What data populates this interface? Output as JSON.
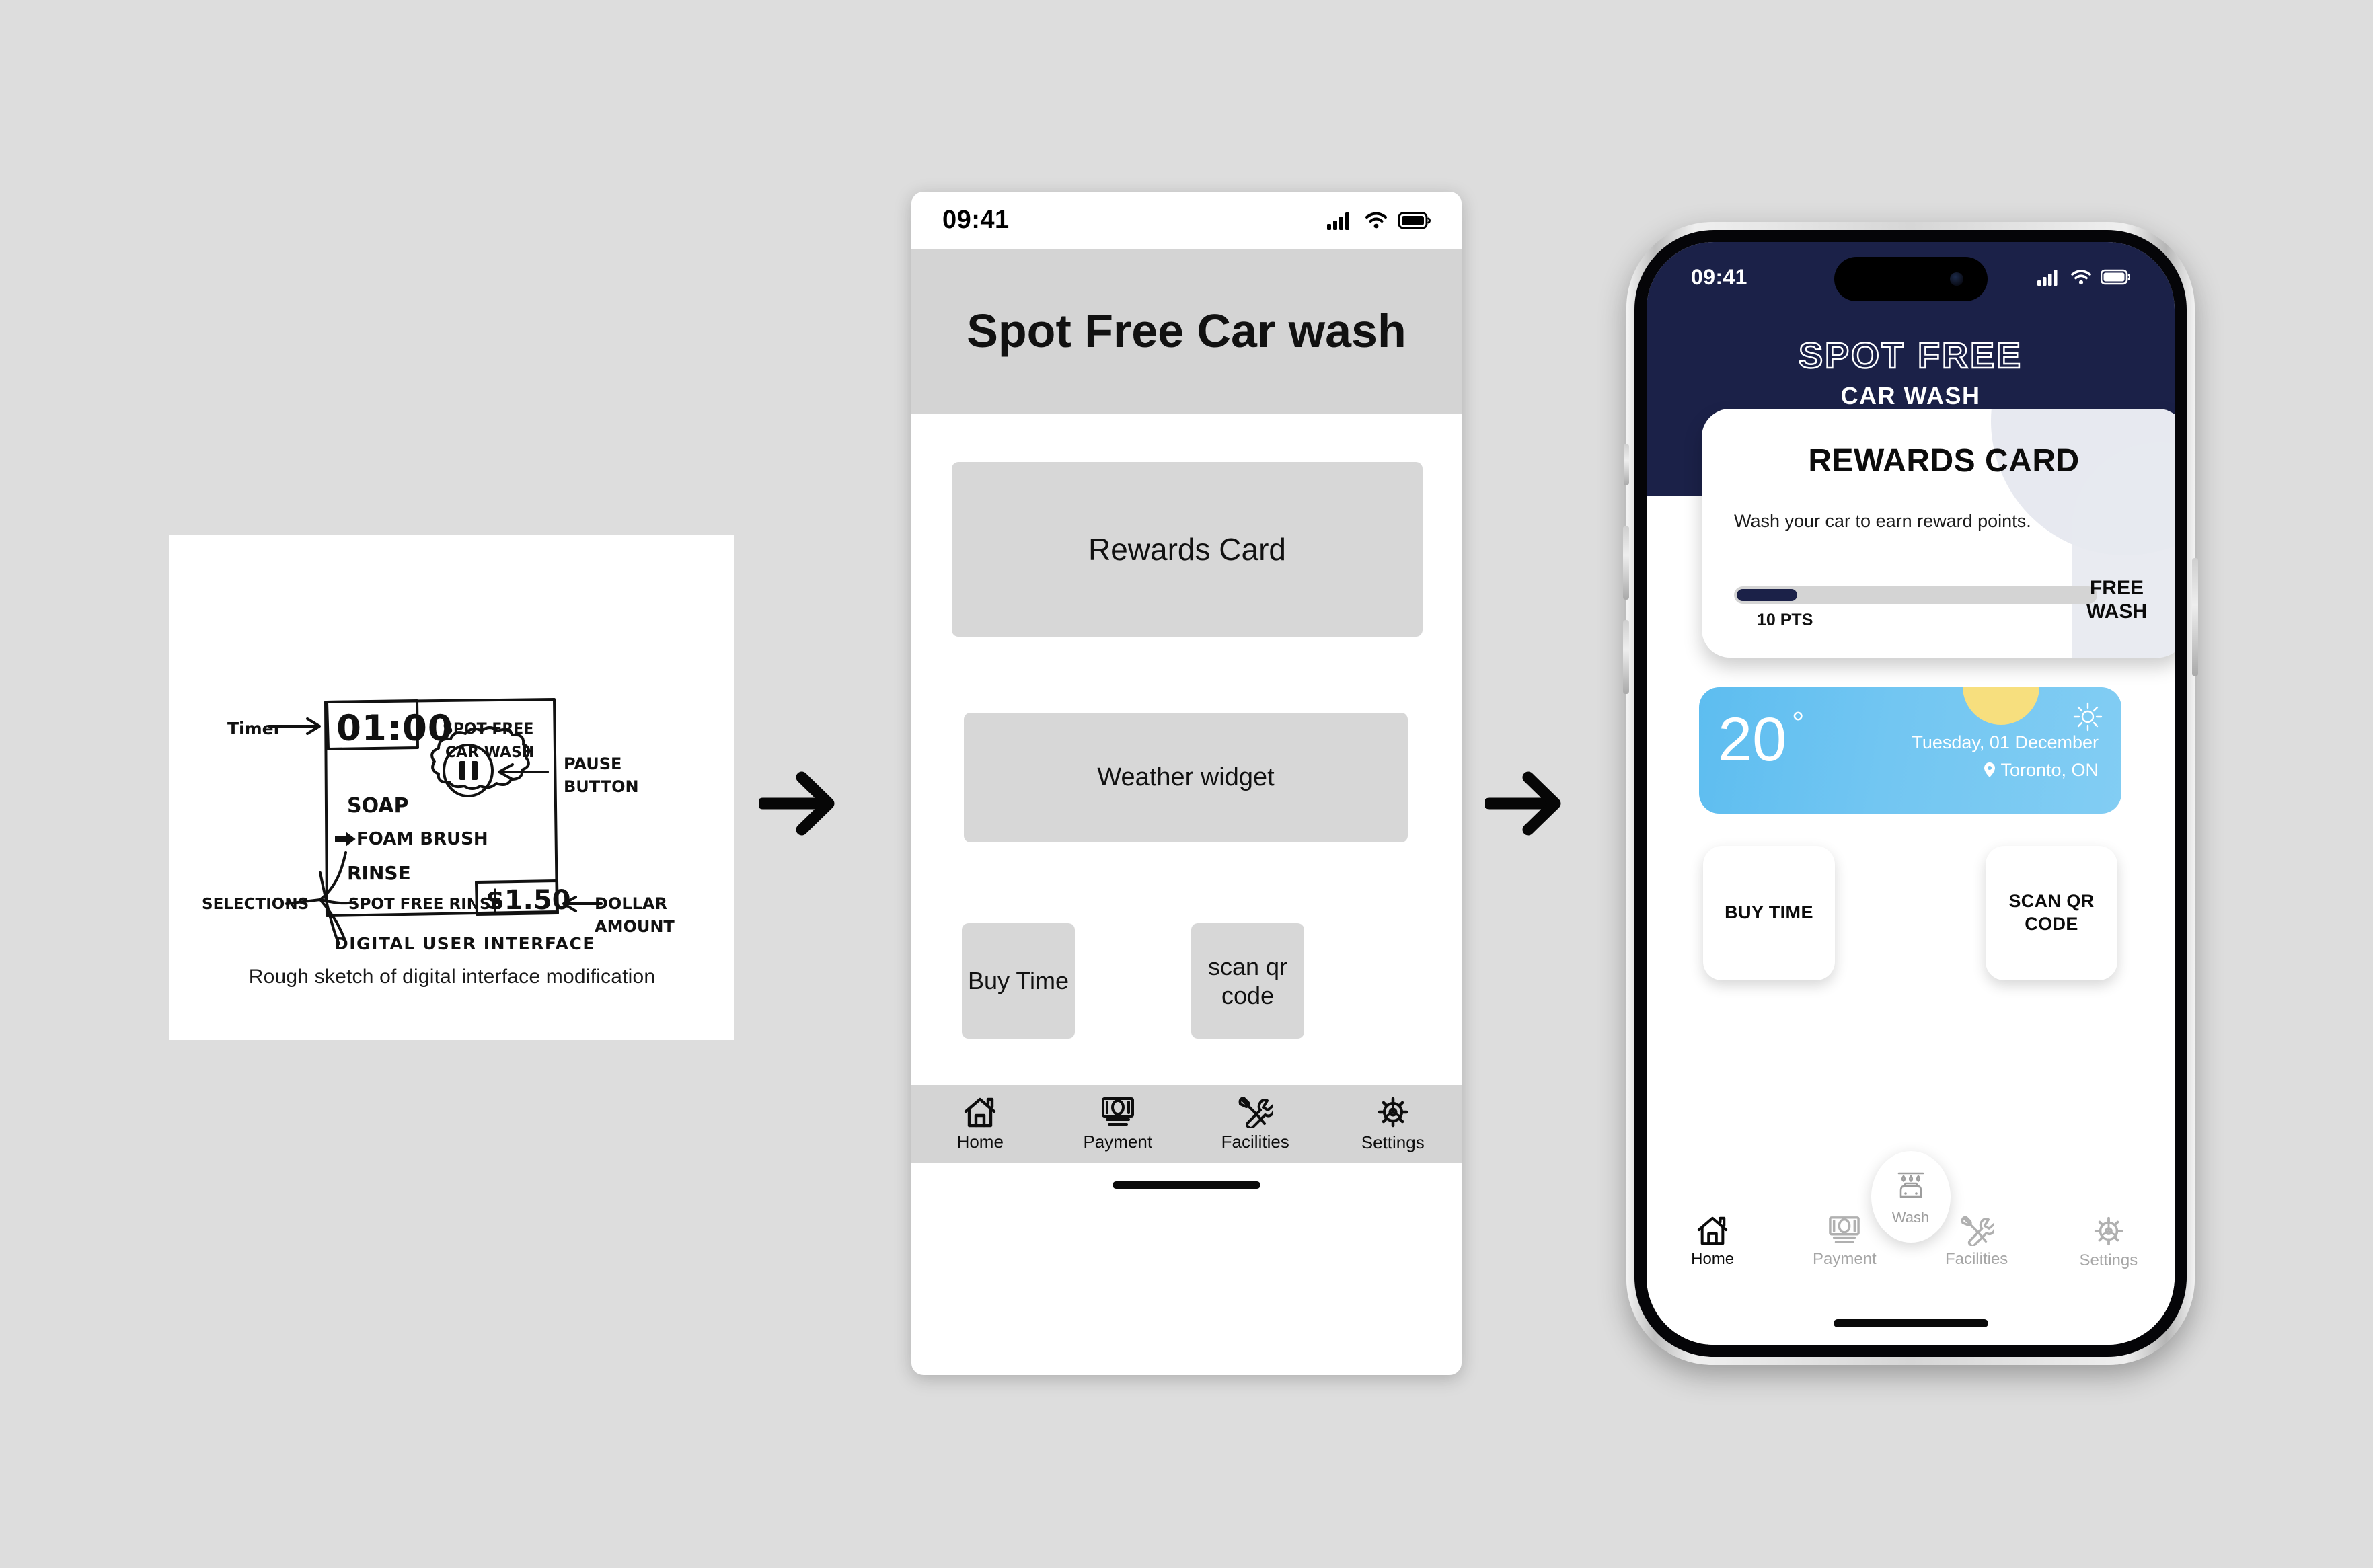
{
  "sketch": {
    "caption": "Rough sketch of digital interface modification",
    "title": "DIGITAL USER INTERFACE",
    "timer_label": "Timer",
    "timer_value": "01:00",
    "machine_brand_line1": "SPOT FREE",
    "machine_brand_line2": "CAR WASH",
    "selections_label": "SELECTIONS",
    "selections": [
      "SOAP",
      "FOAM BRUSH",
      "RINSE",
      "SPOT FREE RINSE"
    ],
    "pause_label_line1": "PAUSE",
    "pause_label_line2": "BUTTON",
    "dollar_value": "$1.50",
    "dollar_label_line1": "DOLLAR",
    "dollar_label_line2": "AMOUNT"
  },
  "arrows": {
    "icon": "arrow-right-icon"
  },
  "wireframe": {
    "status": {
      "time": "09:41",
      "cellular": "signal-icon",
      "wifi": "wifi-icon",
      "battery": "battery-icon"
    },
    "title": "Spot Free Car wash",
    "blocks": {
      "rewards": "Rewards Card",
      "weather": "Weather widget",
      "buy_time": "Buy Time",
      "scan_qr": "scan qr code"
    },
    "nav": [
      {
        "label": "Home",
        "icon": "home-icon"
      },
      {
        "label": "Payment",
        "icon": "money-icon"
      },
      {
        "label": "Facilities",
        "icon": "tools-icon"
      },
      {
        "label": "Settings",
        "icon": "gear-icon"
      }
    ]
  },
  "app": {
    "status": {
      "time": "09:41",
      "cellular": "signal-icon",
      "wifi": "wifi-icon",
      "battery": "battery-icon"
    },
    "brand": {
      "top": "SPOT FREE",
      "sub": "CAR WASH"
    },
    "rewards": {
      "title": "REWARDS CARD",
      "subtitle": "Wash your car to earn reward points.",
      "points": "10 PTS",
      "progress_percent": 17,
      "goal_line1": "FREE",
      "goal_line2": "WASH",
      "accent": "#1b2148"
    },
    "weather": {
      "temperature": "20",
      "degree": "°",
      "date": "Tuesday, 01 December",
      "location": "Toronto, ON",
      "condition_icon": "sun-icon",
      "location_icon": "pin-icon",
      "sky_color": "#72c6f2",
      "sun_color": "#f7df7e"
    },
    "actions": [
      {
        "label": "BUY TIME",
        "name": "buy-time"
      },
      {
        "label": "SCAN QR CODE",
        "name": "scan-qr-code"
      }
    ],
    "fab": {
      "label": "Wash",
      "icon": "car-wash-icon"
    },
    "nav": [
      {
        "label": "Home",
        "icon": "home-icon",
        "active": true
      },
      {
        "label": "Payment",
        "icon": "money-icon",
        "active": false
      },
      {
        "label": "Facilities",
        "icon": "tools-icon",
        "active": false
      },
      {
        "label": "Settings",
        "icon": "gear-icon",
        "active": false
      }
    ]
  }
}
